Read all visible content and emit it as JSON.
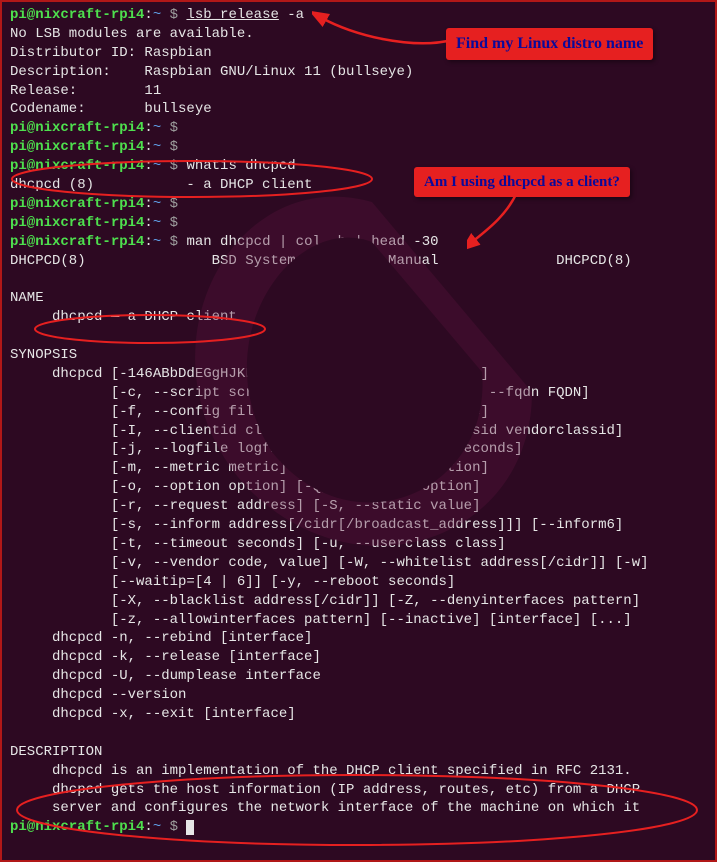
{
  "prompt": {
    "user": "pi@nixcraft-rpi4",
    "path": "~",
    "sep": ":",
    "sigil": "$"
  },
  "commands": {
    "c1": "lsb_release -a",
    "c2": "$",
    "c3": "whatis dhcpcd",
    "c4": "man dhcpcd | col -b | head -30"
  },
  "output": {
    "lsb1": "No LSB modules are available.",
    "lsb2": "Distributor ID: Raspbian",
    "lsb3": "Description:    Raspbian GNU/Linux 11 (bullseye)",
    "lsb4": "Release:        11",
    "lsb5": "Codename:       bullseye",
    "whatis": "dhcpcd (8)           - a DHCP client",
    "man_hdr": "DHCPCD(8)               BSD System Manager's Manual              DHCPCD(8)",
    "man_name_h": "NAME",
    "man_name": "     dhcpcd — a DHCP client",
    "man_syn_h": "SYNOPSIS",
    "syn1": "     dhcpcd [-146ABbDdEGgHJKLMNPpqTV] [-C, --nohook hook]",
    "syn2": "            [-c, --script script] [-e, --env value] [-F, --fqdn FQDN]",
    "syn3": "            [-f, --config file] [-h, --hostname hostname]",
    "syn4": "            [-I, --clientid clientid] [-i, --vendorclassid vendorclassid]",
    "syn5": "            [-j, --logfile logfile] [-l, --leasetime seconds]",
    "syn6": "            [-m, --metric metric] [-O, --nooption option]",
    "syn7": "            [-o, --option option] [-Q, --require option]",
    "syn8": "            [-r, --request address] [-S, --static value]",
    "syn9": "            [-s, --inform address[/cidr[/broadcast_address]]] [--inform6]",
    "syn10": "            [-t, --timeout seconds] [-u, --userclass class]",
    "syn11": "            [-v, --vendor code, value] [-W, --whitelist address[/cidr]] [-w]",
    "syn12": "            [--waitip=[4 | 6]] [-y, --reboot seconds]",
    "syn13": "            [-X, --blacklist address[/cidr]] [-Z, --denyinterfaces pattern]",
    "syn14": "            [-z, --allowinterfaces pattern] [--inactive] [interface] [...]",
    "syn15": "     dhcpcd -n, --rebind [interface]",
    "syn16": "     dhcpcd -k, --release [interface]",
    "syn17": "     dhcpcd -U, --dumplease interface",
    "syn18": "     dhcpcd --version",
    "syn19": "     dhcpcd -x, --exit [interface]",
    "man_desc_h": "DESCRIPTION",
    "desc1": "     dhcpcd is an implementation of the DHCP client specified in RFC 2131.",
    "desc2": "     dhcpcd gets the host information (IP address, routes, etc) from a DHCP",
    "desc3": "     server and configures the network interface of the machine on which it"
  },
  "callouts": {
    "a": "Find my Linux distro name",
    "b": "Am I using dhcpcd as a client?"
  }
}
